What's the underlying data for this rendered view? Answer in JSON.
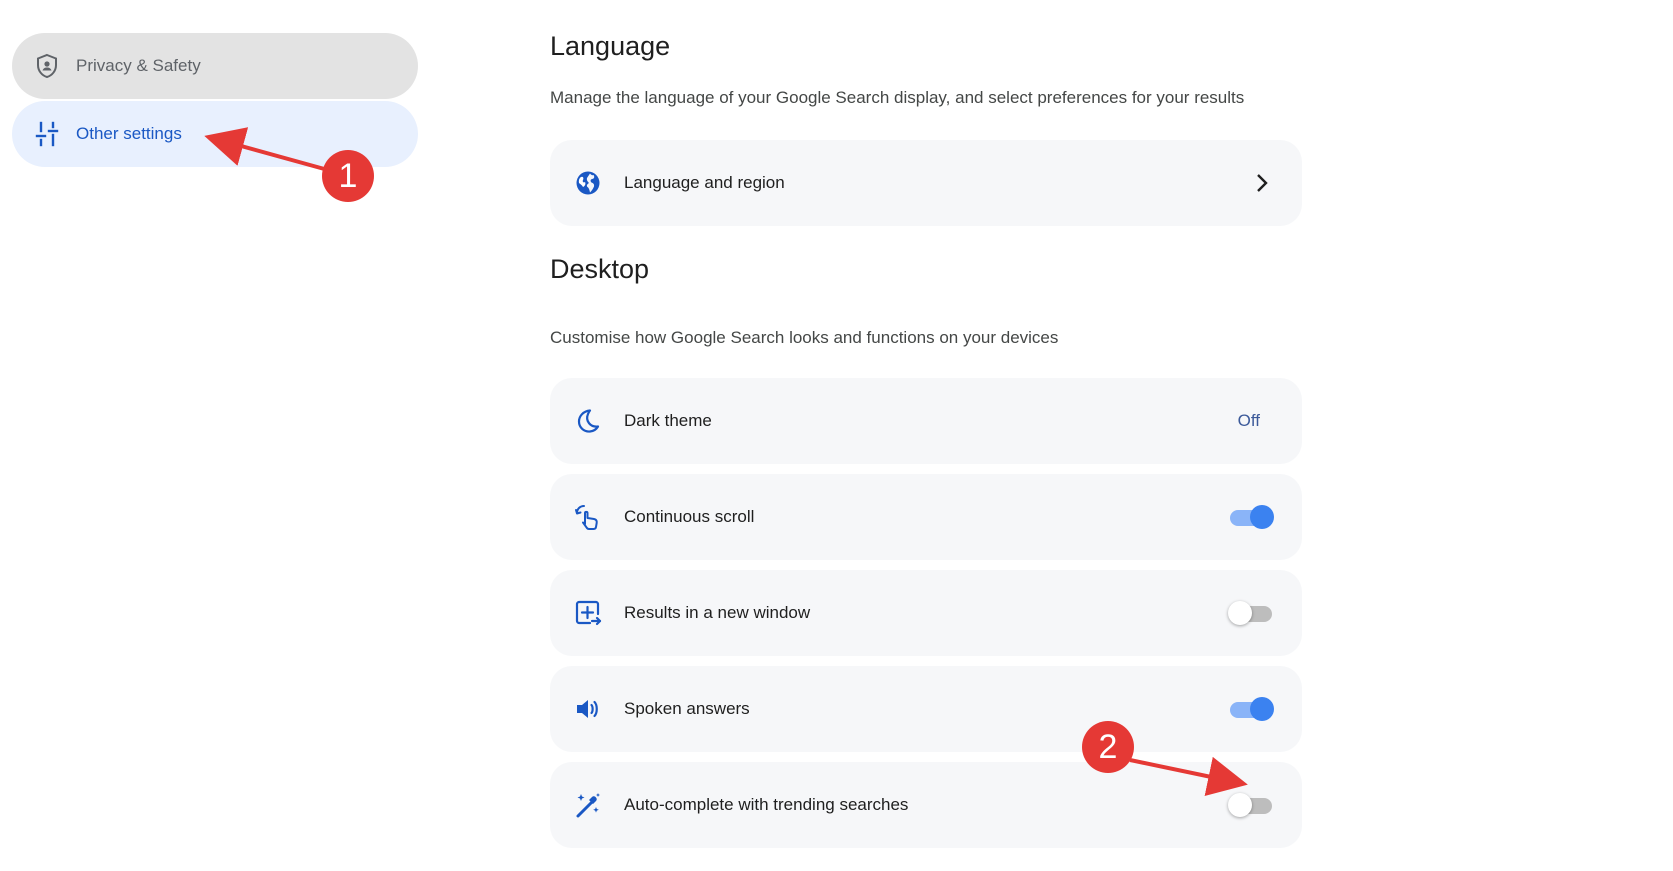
{
  "sidebar": {
    "items": [
      {
        "label": "Privacy & Safety",
        "icon": "shield-icon"
      },
      {
        "label": "Other settings",
        "icon": "sliders-icon",
        "selected": true
      }
    ]
  },
  "language_section": {
    "title": "Language",
    "description": "Manage the language of your Google Search display, and select preferences for your results",
    "rows": [
      {
        "label": "Language and region",
        "icon": "globe-icon"
      }
    ]
  },
  "desktop_section": {
    "title": "Desktop",
    "description": "Customise how Google Search looks and functions on your devices",
    "rows": [
      {
        "label": "Dark theme",
        "icon": "moon-icon",
        "value": "Off"
      },
      {
        "label": "Continuous scroll",
        "icon": "scroll-gesture-icon",
        "toggle": true
      },
      {
        "label": "Results in a new window",
        "icon": "new-window-icon",
        "toggle": false
      },
      {
        "label": "Spoken answers",
        "icon": "speaker-icon",
        "toggle": true
      },
      {
        "label": "Auto-complete with trending searches",
        "icon": "magic-wand-icon",
        "toggle": false
      }
    ]
  },
  "annotations": {
    "badge_1": "1",
    "badge_2": "2",
    "color": "#e53935"
  },
  "colors": {
    "accent": "#1a73e8",
    "selected_bg": "#e8f0fe",
    "card_bg": "#f6f7f9"
  }
}
